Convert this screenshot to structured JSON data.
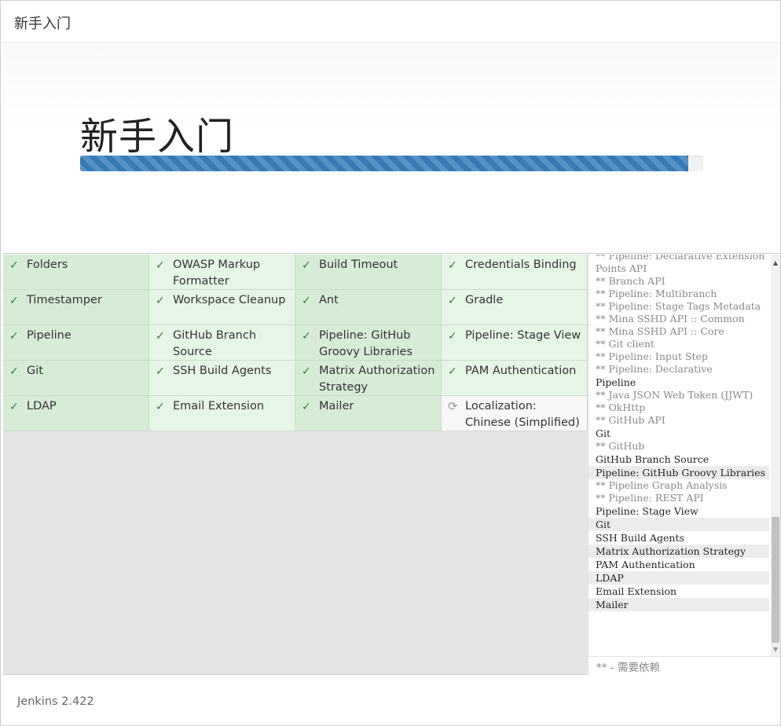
{
  "header": {
    "title": "新手入门"
  },
  "jumbotron": {
    "title": "新手入门",
    "progress_percent": 97.6
  },
  "plugins": [
    {
      "name": "Folders",
      "status": "success"
    },
    {
      "name": "OWASP Markup Formatter",
      "status": "success"
    },
    {
      "name": "Build Timeout",
      "status": "success"
    },
    {
      "name": "Credentials Binding",
      "status": "success"
    },
    {
      "name": "Timestamper",
      "status": "success"
    },
    {
      "name": "Workspace Cleanup",
      "status": "success"
    },
    {
      "name": "Ant",
      "status": "success"
    },
    {
      "name": "Gradle",
      "status": "success"
    },
    {
      "name": "Pipeline",
      "status": "success"
    },
    {
      "name": "GitHub Branch Source",
      "status": "success"
    },
    {
      "name": "Pipeline: GitHub Groovy Libraries",
      "status": "success"
    },
    {
      "name": "Pipeline: Stage View",
      "status": "success"
    },
    {
      "name": "Git",
      "status": "success"
    },
    {
      "name": "SSH Build Agents",
      "status": "success"
    },
    {
      "name": "Matrix Authorization Strategy",
      "status": "success"
    },
    {
      "name": "PAM Authentication",
      "status": "success"
    },
    {
      "name": "LDAP",
      "status": "success"
    },
    {
      "name": "Email Extension",
      "status": "success"
    },
    {
      "name": "Mailer",
      "status": "success"
    },
    {
      "name": "Localization: Chinese (Simplified)",
      "status": "loading"
    }
  ],
  "icons": {
    "success": "check-icon",
    "loading": "refresh-icon"
  },
  "log": {
    "lines": [
      {
        "text": "** Pipeline: Declarative Extension Points API",
        "dep": true
      },
      {
        "text": "** Branch API",
        "dep": true
      },
      {
        "text": "** Pipeline: Multibranch",
        "dep": true
      },
      {
        "text": "** Pipeline: Stage Tags Metadata",
        "dep": true
      },
      {
        "text": "** Mina SSHD API :: Common",
        "dep": true
      },
      {
        "text": "** Mina SSHD API :: Core",
        "dep": true
      },
      {
        "text": "** Git client",
        "dep": true
      },
      {
        "text": "** Pipeline: Input Step",
        "dep": true
      },
      {
        "text": "** Pipeline: Declarative",
        "dep": true
      },
      {
        "text": "Pipeline",
        "dep": false
      },
      {
        "text": "** Java JSON Web Token (JJWT)",
        "dep": true
      },
      {
        "text": "** OkHttp",
        "dep": true
      },
      {
        "text": "** GitHub API",
        "dep": true
      },
      {
        "text": "Git",
        "dep": false
      },
      {
        "text": "** GitHub",
        "dep": true
      },
      {
        "text": "GitHub Branch Source",
        "dep": false
      },
      {
        "text": "Pipeline: GitHub Groovy Libraries",
        "dep": false,
        "shaded": true
      },
      {
        "text": "** Pipeline Graph Analysis",
        "dep": true
      },
      {
        "text": "** Pipeline: REST API",
        "dep": true
      },
      {
        "text": "Pipeline: Stage View",
        "dep": false
      },
      {
        "text": "Git",
        "dep": false,
        "shaded": true
      },
      {
        "text": "SSH Build Agents",
        "dep": false
      },
      {
        "text": "Matrix Authorization Strategy",
        "dep": false,
        "shaded": true
      },
      {
        "text": "PAM Authentication",
        "dep": false
      },
      {
        "text": "LDAP",
        "dep": false,
        "shaded": true
      },
      {
        "text": "Email Extension",
        "dep": false
      },
      {
        "text": "Mailer",
        "dep": false,
        "shaded": true
      }
    ],
    "legend": "** - 需要依赖"
  },
  "footer": {
    "version": "Jenkins 2.422"
  }
}
